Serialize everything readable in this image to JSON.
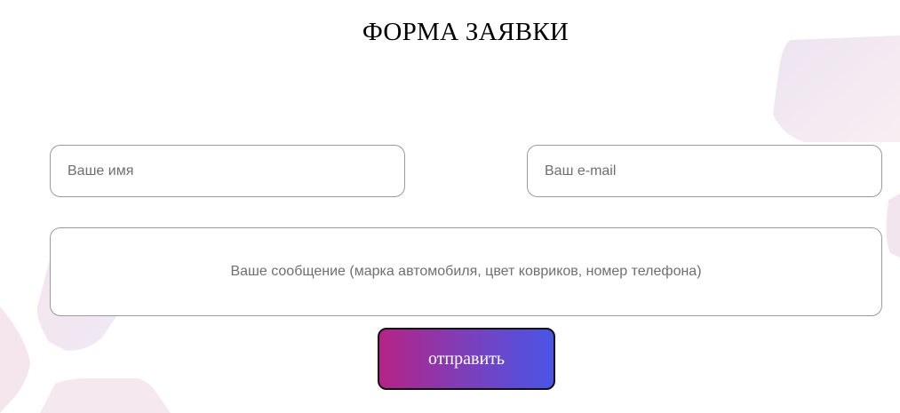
{
  "form": {
    "title": "ФОРМА ЗАЯВКИ",
    "name_placeholder": "Ваше имя",
    "email_placeholder": "Ваш e-mail",
    "message_placeholder": "Ваше сообщение (марка автомобиля, цвет ковриков, номер телефона)",
    "submit_label": "отправить"
  },
  "colors": {
    "submit_gradient_start": "#b52386",
    "submit_gradient_end": "#4a55e8",
    "field_border": "#9a9a9a",
    "decor_tint": "#ede6f1"
  }
}
